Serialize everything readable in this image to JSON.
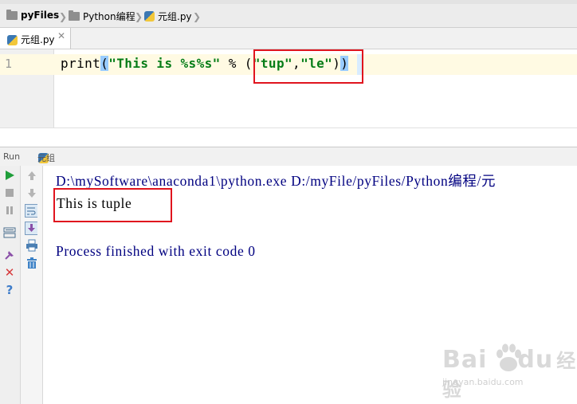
{
  "breadcrumb": {
    "items": [
      {
        "label": "pyFiles",
        "icon": "folder-icon"
      },
      {
        "label": "Python编程",
        "icon": "folder-icon"
      },
      {
        "label": "元组.py",
        "icon": "python-file-icon"
      }
    ]
  },
  "editor": {
    "tab_label": "元组.py",
    "line_number": "1",
    "code": {
      "fn": "print",
      "open_paren": "(",
      "string": "\"This is %s%s\"",
      "operator": " % ",
      "tuple_open": "(",
      "arg1": "\"tup\"",
      "comma": ",",
      "arg2": "\"le\"",
      "tuple_close": ")",
      "close_paren": ")"
    }
  },
  "run_panel": {
    "title": "Run",
    "config_name": "元组",
    "toolbar_left": [
      "run-icon",
      "stop-icon",
      "pause-icon",
      "layout-icon",
      "pin-icon",
      "close-icon",
      "help-icon"
    ],
    "toolbar_right": [
      "up-arrow-icon",
      "down-arrow-icon",
      "soft-wrap-icon",
      "scroll-to-end-icon",
      "print-icon",
      "trash-icon"
    ]
  },
  "console": {
    "command": "D:\\mySoftware\\anaconda1\\python.exe D:/myFile/pyFiles/Python编程/元",
    "output": "This is tuple",
    "process": "Process finished with exit code 0"
  },
  "watermark": {
    "main": "Bai",
    "du": "du",
    "jingyan": "经验",
    "sub": "jingyan.baidu.com"
  },
  "colors": {
    "annotation_red": "#e0141e",
    "console_blue": "#000080",
    "string_green": "#067d17",
    "paren_highlight": "#99ccff",
    "current_line": "#fffae3"
  }
}
